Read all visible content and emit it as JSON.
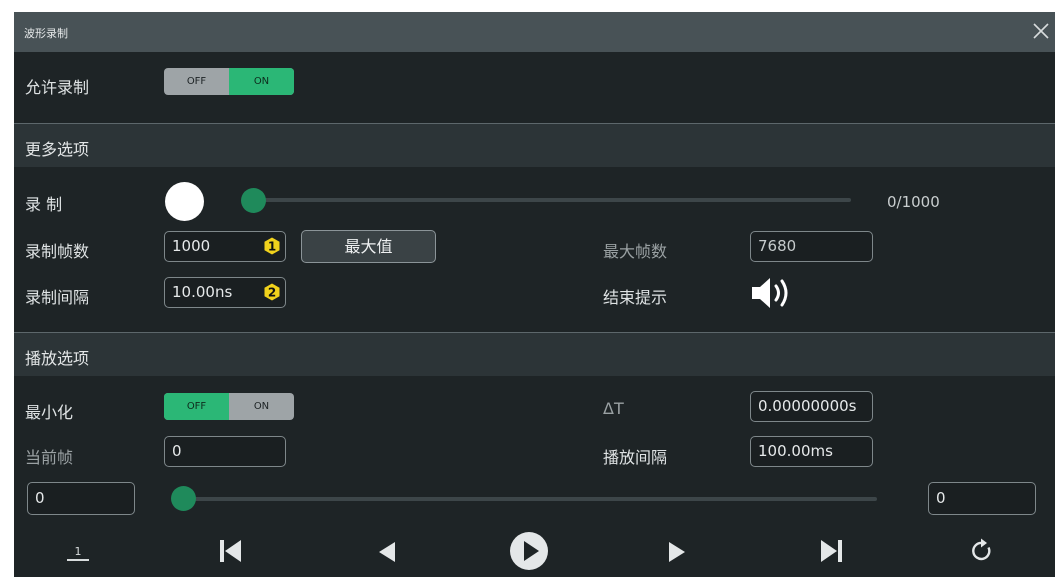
{
  "window": {
    "title": "波形录制"
  },
  "enable": {
    "label": "允许录制",
    "off_label": "OFF",
    "on_label": "ON",
    "state": "ON"
  },
  "more_options": {
    "header": "更多选项",
    "record_label": "录 制",
    "record_progress": "0/1000",
    "record_position": 0,
    "frames_label": "录制帧数",
    "frames_value": "1000",
    "frames_badge": "1",
    "max_button": "最大值",
    "interval_label": "录制间隔",
    "interval_value": "10.00ns",
    "interval_badge": "2",
    "max_frames_label": "最大帧数",
    "max_frames_value": "7680",
    "end_prompt_label": "结束提示",
    "end_prompt_icon": "speaker-icon"
  },
  "playback_options": {
    "header": "播放选项",
    "minimize_label": "最小化",
    "minimize_off": "OFF",
    "minimize_on": "ON",
    "minimize_state": "OFF",
    "delta_t_label": "ΔT",
    "delta_t_value": "0.00000000s",
    "current_frame_label": "当前帧",
    "current_frame_value": "0",
    "play_interval_label": "播放间隔",
    "play_interval_value": "100.00ms",
    "range_start": "0",
    "range_end": "0",
    "range_position": 0
  },
  "controls": [
    "step-mode-icon",
    "skip-to-start-icon",
    "previous-frame-icon",
    "play-icon",
    "next-frame-icon",
    "skip-to-end-icon",
    "repeat-icon"
  ],
  "colors": {
    "accent_green": "#2bb776",
    "badge_yellow": "#f1d21c",
    "panel_bg": "#1e2426"
  }
}
